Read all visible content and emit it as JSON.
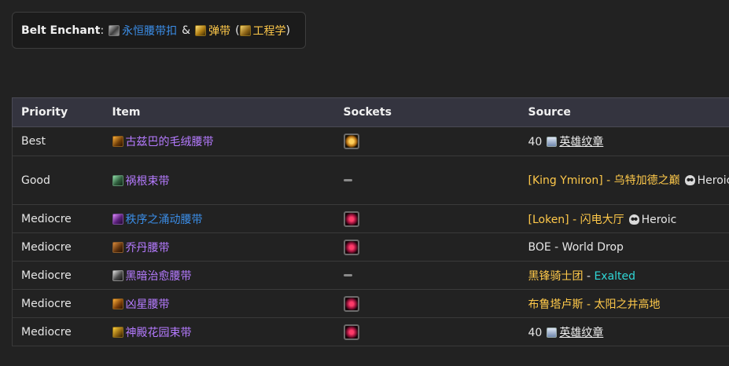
{
  "enchant": {
    "label": "Belt Enchant",
    "colon": ":",
    "item1": "永恒腰带扣",
    "amp": "&",
    "item2": "弹带",
    "paren_open": "(",
    "item3": "工程学",
    "paren_close": ")"
  },
  "table": {
    "headers": [
      "Priority",
      "Item",
      "Sockets",
      "Source"
    ],
    "rows": [
      {
        "priority": "Best",
        "item": "古兹巴的毛绒腰带",
        "socket": "yellow",
        "source_num": "40",
        "source_link": "英雄纹章"
      },
      {
        "priority": "Good",
        "item": "祸根束带",
        "socket": "none",
        "source_boss": "[King Ymiron]",
        "source_dash": " - ",
        "source_place": "乌特加德之巅",
        "source_mode": "Heroic"
      },
      {
        "priority": "Mediocre",
        "item": "秩序之涌动腰带",
        "socket": "red",
        "source_boss": "[Loken]",
        "source_dash": " - ",
        "source_place": "闪电大厅",
        "source_mode": "Heroic"
      },
      {
        "priority": "Mediocre",
        "item": "乔丹腰带",
        "socket": "red",
        "source_text": "BOE - World Drop"
      },
      {
        "priority": "Mediocre",
        "item": "黑暗治愈腰带",
        "socket": "none",
        "source_faction": "黑锋骑士团",
        "source_dash": " - ",
        "source_rep": "Exalted"
      },
      {
        "priority": "Mediocre",
        "item": "凶星腰带",
        "socket": "red",
        "source_boss": "布鲁塔卢斯",
        "source_dash": " - ",
        "source_place": "太阳之井高地"
      },
      {
        "priority": "Mediocre",
        "item": "神殿花园束带",
        "socket": "red",
        "source_num": "40",
        "source_link": "英雄纹章"
      }
    ]
  },
  "colors": {
    "background": "#222222",
    "header_bg": "#34343f",
    "link_blue": "#3b8ee8",
    "yellow": "#ffc94a",
    "epic_purple": "#b57bff",
    "exalted_cyan": "#2fd6d6"
  },
  "icons": {
    "enchant": "enchant-scroll-icon",
    "bullet": "ammo-pouch-icon",
    "engineering": "engineering-icon",
    "badge": "badge-of-justice-icon",
    "heroic": "skull-icon"
  }
}
